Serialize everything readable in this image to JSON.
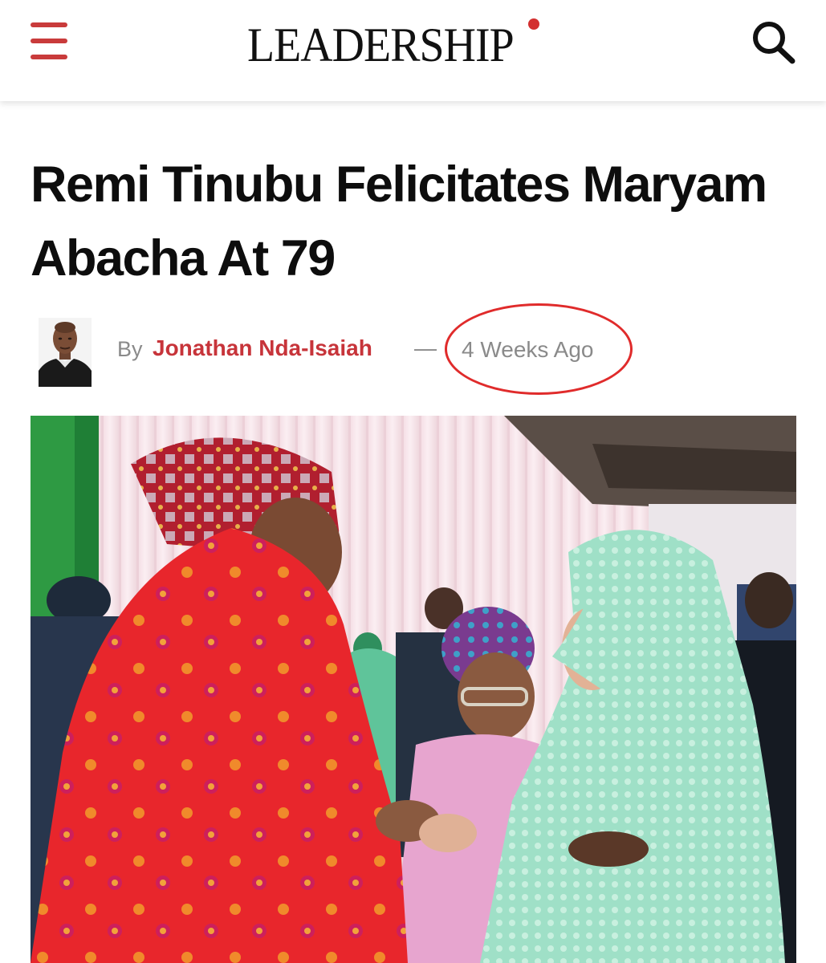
{
  "header": {
    "logo_text": "LEADERSHIP",
    "menu_icon": "hamburger-menu-icon",
    "search_icon": "search-icon",
    "accent_color": "#c93b3b"
  },
  "article": {
    "headline": "Remi Tinubu Felicitates Maryam Abacha At 79",
    "by_label": "By",
    "author": "Jonathan Nda-Isaiah",
    "separator": "—",
    "date": "4 Weeks Ago"
  },
  "colors": {
    "author_link": "#c7343a",
    "annotation_circle": "#e02b2b"
  }
}
